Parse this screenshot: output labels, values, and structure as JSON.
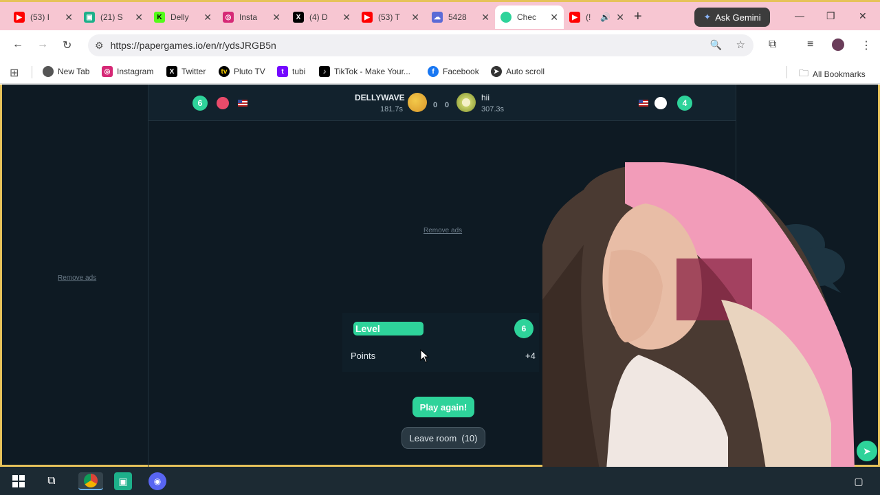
{
  "browser": {
    "tabs": [
      {
        "title": "(53) I",
        "icon": "youtube-icon",
        "color": "#ff0000"
      },
      {
        "title": "(21) S",
        "icon": "twitch-like-icon",
        "color": "#1db08a"
      },
      {
        "title": "Delly",
        "icon": "kick-icon",
        "color": "#53fc18"
      },
      {
        "title": "Insta",
        "icon": "instagram-icon",
        "color": "#d62976"
      },
      {
        "title": "(4) D",
        "icon": "x-icon",
        "color": "#000000"
      },
      {
        "title": "(53) T",
        "icon": "youtube-icon",
        "color": "#ff0000"
      },
      {
        "title": "5428",
        "icon": "ghost-icon",
        "color": "#5b6bd6"
      },
      {
        "title": "Chec",
        "icon": "papergames-icon",
        "color": "#2ed39a",
        "active": true
      },
      {
        "title": "(!",
        "icon": "youtube-icon",
        "color": "#ff0000"
      }
    ],
    "ask_gemini": "Ask Gemini",
    "url": "https://papergames.io/en/r/ydsJRGB5n",
    "bookmarks": [
      {
        "label": "New Tab",
        "icon": "chrome-icon",
        "color": "#555555"
      },
      {
        "label": "Instagram",
        "icon": "instagram-icon",
        "color": "#d62976"
      },
      {
        "label": "Twitter",
        "icon": "x-icon",
        "color": "#000000"
      },
      {
        "label": "Pluto TV",
        "icon": "pluto-tv-icon",
        "color": "#000000"
      },
      {
        "label": "tubi",
        "icon": "tubi-icon",
        "color": "#7408ff"
      },
      {
        "label": "TikTok - Make Your...",
        "icon": "tiktok-icon",
        "color": "#000000"
      },
      {
        "label": "Facebook",
        "icon": "facebook-icon",
        "color": "#1877f2"
      },
      {
        "label": "Auto scroll",
        "icon": "auto-scroll-icon",
        "color": "#333333"
      }
    ],
    "all_bookmarks": "All Bookmarks"
  },
  "game": {
    "left_player": {
      "level": "6",
      "name": "DELLYWAVE",
      "time": "181.7s",
      "score": "0",
      "color": "#e94b6a"
    },
    "right_player": {
      "level": "4",
      "name": "hii",
      "time": "307.3s",
      "score": "0",
      "color": "#ffffff"
    },
    "remove_ads": "Remove ads",
    "result": {
      "level_label": "Level",
      "level_value": "6",
      "points_label": "Points",
      "points_value": "+4"
    },
    "play_again": "Play again!",
    "leave_room": "Leave room  (10)"
  }
}
